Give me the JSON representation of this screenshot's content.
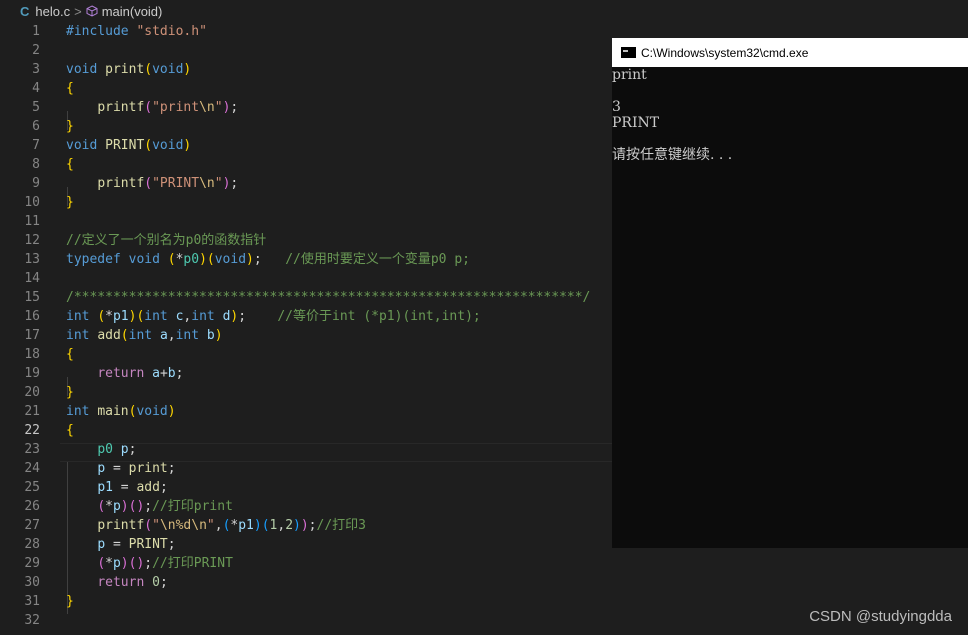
{
  "breadcrumb": {
    "lang_icon": "C",
    "file": "helo.c",
    "separator": ">",
    "symbol": "main(void)"
  },
  "editor": {
    "line_numbers": [
      "1",
      "2",
      "3",
      "4",
      "5",
      "6",
      "7",
      "8",
      "9",
      "10",
      "11",
      "12",
      "13",
      "14",
      "15",
      "16",
      "17",
      "18",
      "19",
      "20",
      "21",
      "22",
      "23",
      "24",
      "25",
      "26",
      "27",
      "28",
      "29",
      "30",
      "31",
      "32"
    ],
    "active_line": "22"
  },
  "cmd": {
    "title": "C:\\Windows\\system32\\cmd.exe",
    "output": "print\n\n3\nPRINT\n\n请按任意键继续. . ."
  },
  "watermark": "CSDN @studyingdda",
  "colors": {
    "editor_bg": "#1e1e1e",
    "keyword": "#569cd6",
    "function": "#dcdcaa",
    "string": "#ce9178",
    "comment": "#6a9955",
    "console_bg": "#0c0c0c"
  }
}
